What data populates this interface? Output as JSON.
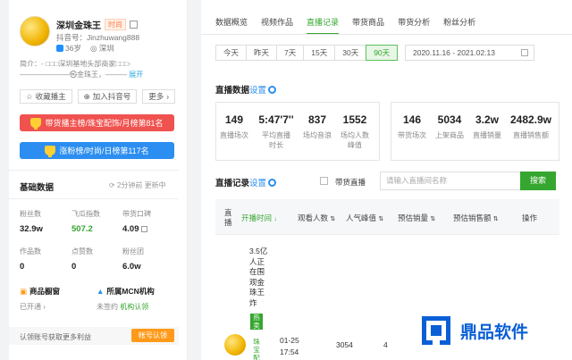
{
  "profile": {
    "name": "深圳金珠王",
    "tag": "时尚",
    "account": "抖音号：Jinzhuwang888",
    "age": "36岁",
    "location": "深圳",
    "intro": "简介：- □□□深圳基地头部商家□□□-",
    "intro2": "———————㉿金珠王，———",
    "intro_more": "展开"
  },
  "actions": {
    "collect": "收藏播主",
    "add": "加入抖音号",
    "more": "更多"
  },
  "ranks": {
    "red": "带货播主榜/珠宝配饰/月榜第81名",
    "blue": "涨粉榜/时尚/日榜第117名"
  },
  "basic": {
    "title": "基础数据",
    "update": "2分钟前  更新中",
    "stats": [
      {
        "label": "粉丝数",
        "value": "32.9w"
      },
      {
        "label": "飞瓜指数",
        "value": "507.2"
      },
      {
        "label": "带货口碑",
        "value": "4.09"
      },
      {
        "label": "作品数",
        "value": "0"
      },
      {
        "label": "点赞数",
        "value": "0"
      },
      {
        "label": "粉丝团",
        "value": "6.0w"
      }
    ]
  },
  "features": {
    "window_title": "商品橱窗",
    "window_status": "已开通",
    "mcn_title": "所属MCN机构",
    "mcn_status": "未签约",
    "mcn_link": "机构认领"
  },
  "claim": {
    "text": "认领账号获取更多利益",
    "button": "帐号认领"
  },
  "tabs": [
    "数据概览",
    "视频作品",
    "直播记录",
    "带货商品",
    "带货分析",
    "粉丝分析"
  ],
  "active_tab": "直播记录",
  "ranges": [
    "今天",
    "昨天",
    "7天",
    "15天",
    "30天",
    "90天"
  ],
  "active_range": "90天",
  "date_range": "2020.11.16 - 2021.02.13",
  "live_data": {
    "title": "直播数据",
    "setting": "设置",
    "card1": [
      {
        "num": "149",
        "label": "直播场次"
      },
      {
        "num": "5:47'7''",
        "label": "平均直播时长"
      },
      {
        "num": "837",
        "label": "场均音浪"
      },
      {
        "num": "1552",
        "label": "场均人数峰值"
      }
    ],
    "card2": [
      {
        "num": "146",
        "label": "带货场次"
      },
      {
        "num": "5034",
        "label": "上架商品"
      },
      {
        "num": "3.2w",
        "label": "直播销量"
      },
      {
        "num": "2482.9w",
        "label": "直播销售额"
      }
    ]
  },
  "records": {
    "title": "直播记录",
    "setting": "设置",
    "filter": "带货直播",
    "search_placeholder": "请输入直播间名称",
    "search_button": "搜索",
    "headers": [
      "直播",
      "开播时间",
      "观看人数",
      "人气峰值",
      "预估销量",
      "预估销售额",
      "操作"
    ],
    "row": {
      "title": "3.5亿人正在围观金珠王炸",
      "hot": "热卖",
      "hot_sub": "珠宝配",
      "date": "01-25",
      "time": "17:54",
      "viewers": "3054",
      "peak": "4"
    }
  },
  "watermark": "鼎品软件"
}
